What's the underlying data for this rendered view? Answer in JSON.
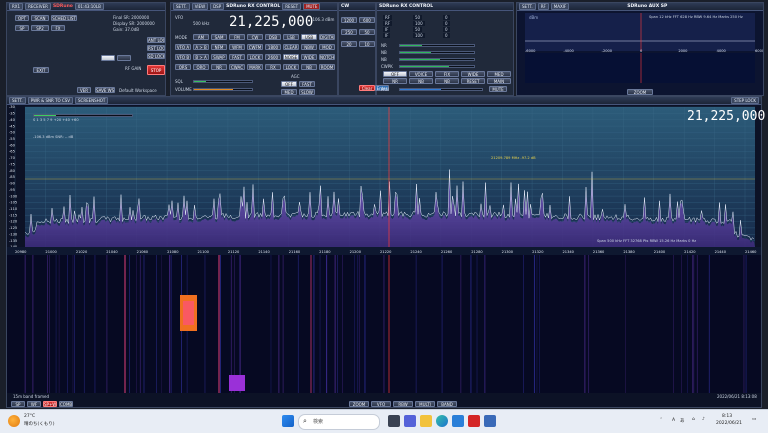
{
  "rx_panel": {
    "title": "RECEIVER",
    "app_name": "SDRuno",
    "menu_mode": "RX1",
    "time": "01:43:10LB",
    "mode_buttons": [
      "OPT",
      "SCAN",
      "SCHED LIST",
      "SP",
      "SP2",
      "FX"
    ],
    "sr_info": [
      "Final SR: 2000000",
      "Display SR: 2000000",
      "Gain: 37.0dB"
    ],
    "side_buttons": [
      "ANT LOCK",
      "RST LOCK",
      "SD LOCK"
    ],
    "stop_label": "STOP",
    "rf_gain": "RF GAIN",
    "default_workspace": "Default Workspace",
    "bottom_buttons": [
      "EXIT",
      "VER",
      "SAVE WS"
    ]
  },
  "control_panel": {
    "title": "SDRuno RX CONTROL",
    "tabs": [
      "SETT.",
      "VIEW",
      "DSP",
      "RESET",
      "MUTE"
    ],
    "freq_label": "FREQ",
    "vfo_label": "VFO",
    "step": "500 kHz",
    "frequency": "21,225,000",
    "level": "-106.3 dBm",
    "mode_label": "MODE",
    "modes": [
      "AM",
      "SAM",
      "FM",
      "CW",
      "DSB",
      "LSB",
      "USB",
      "DIGITAL"
    ],
    "row2": [
      "VFO A",
      "A > B",
      "NFM",
      "WFM",
      "CWFM",
      "1800",
      "CLEAR",
      "NBW",
      "MOD"
    ],
    "row3": [
      "VFO B",
      "B > A",
      "SWAP",
      "FAST",
      "LOCK",
      "2600",
      "NOISE",
      "WIDE",
      "NOTCH"
    ],
    "row4": [
      "QRS",
      "QRQ",
      "NR",
      "CWAC",
      "MARK",
      "RX",
      "LOCK",
      "NB",
      "ROOM"
    ],
    "squelch_label": "SQL",
    "volume_label": "VOLUME",
    "agc_label": "AGC",
    "agc_modes": [
      "OFF",
      "FAST",
      "MED",
      "SLOW"
    ],
    "cw_panel": {
      "title": "CW",
      "values": [
        "1200",
        "600",
        "250",
        "50",
        "20",
        "10"
      ]
    }
  },
  "mem_panel": {
    "title": "SDRuno RX CONTROL",
    "rows": [
      [
        "RF",
        "50",
        "0"
      ],
      [
        "RF",
        "100",
        "0"
      ],
      [
        "IF",
        "50",
        "0"
      ],
      [
        "IF",
        "100",
        "0"
      ]
    ],
    "sliders": [
      "NR",
      "NB",
      "NB",
      "CWPK"
    ],
    "buttons": [
      "OFF",
      "VOICE",
      "FIX",
      "WIDE",
      "MED",
      "NR",
      "NB",
      "NB",
      "RESET",
      "MAIN"
    ],
    "clear_label": "Clear",
    "enter_label": "Enter",
    "pan_label": "PAN",
    "mute_label": "MUTE"
  },
  "aux_sp": {
    "title": "SDRuno AUX SP",
    "tabs": [
      "SETT.",
      "RF",
      "MAXIF"
    ],
    "level": "dBm",
    "info": "Span 12 kHz  FFT 628 Hz  RBW 9.64 Hz  Marks 250 Hz",
    "ticks": [
      "-6000",
      "-4000",
      "-2000",
      "0",
      "2000",
      "4000",
      "6000"
    ],
    "zoom_label": "ZOOM"
  },
  "main_sp": {
    "tabs": [
      "SETT.",
      "PWR & SNR TO CSV",
      "SCREENSHOT"
    ],
    "frequency": "21,225,000",
    "step_lock": "STEP LOCK",
    "smeter_scale": "S  1  3  5  7  9  +20  +40  +60",
    "signal_info": "-106.3 dBm   SNR: -- dB",
    "marker_info": "21209.789 MHz  -97.2 dB",
    "span_info": "Span 500 kHz   FFT 32768 Pts   RBW 15.26 Hz   Marks 0 Hz",
    "y_ticks": [
      "-30",
      "-35",
      "-40",
      "-45",
      "-50",
      "-55",
      "-60",
      "-65",
      "-70",
      "-75",
      "-80",
      "-85",
      "-90",
      "-95",
      "-100",
      "-105",
      "-110",
      "-115",
      "-120",
      "-125",
      "-130",
      "-135",
      "-140"
    ],
    "x_ticks": [
      "20980",
      "21000",
      "21020",
      "21040",
      "21060",
      "21080",
      "21100",
      "21120",
      "21140",
      "21160",
      "21180",
      "21200",
      "21220",
      "21240",
      "21260",
      "21280",
      "21300",
      "21320",
      "21340",
      "21360",
      "21380",
      "21400",
      "21420",
      "21440",
      "21460"
    ],
    "waterfall_label": "15m band framed",
    "timestamp": "2022/06/21 8:13:08",
    "bottom_buttons": [
      "SP",
      "WF",
      "SP+WF",
      "COMBO"
    ],
    "bottom_right_buttons": [
      "ZOOM",
      "VFO",
      "RBW",
      "MULTI",
      "BAND"
    ]
  },
  "taskbar": {
    "weather_temp": "27°C",
    "weather_text": "晴のち(くもり)",
    "search_placeholder": "検索",
    "time": "8:13",
    "date": "2022/06/21",
    "ime_label": "あ",
    "lang_label": "A"
  }
}
